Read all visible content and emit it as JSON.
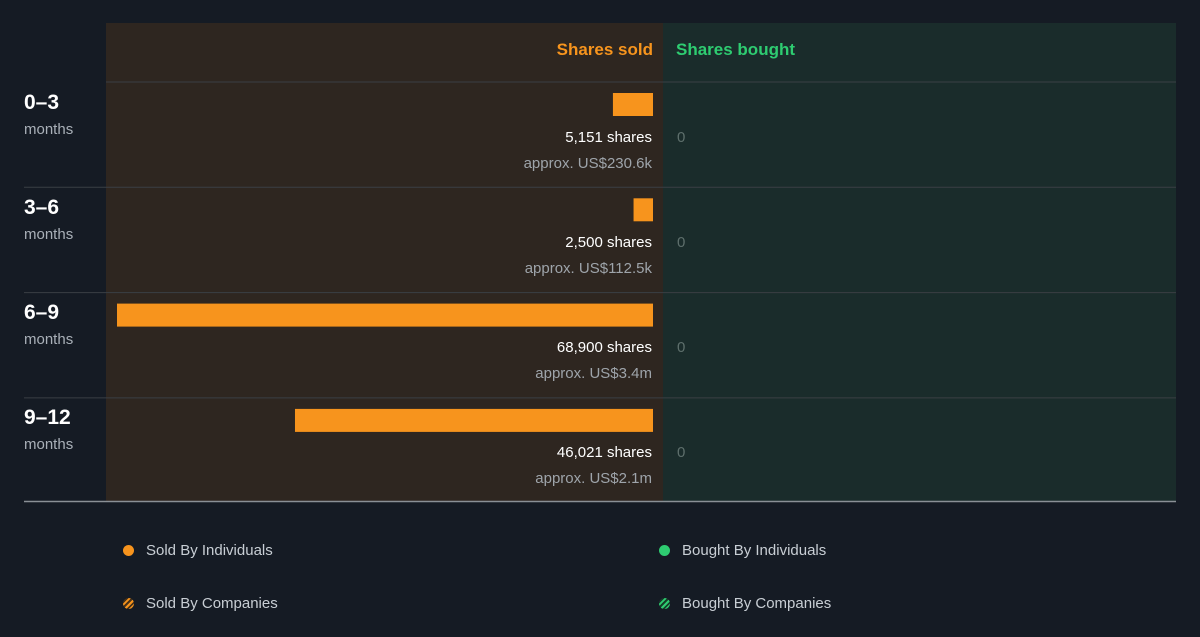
{
  "colors": {
    "sold": "#f7941d",
    "bought": "#2ecc71",
    "sold_bg": "#2e2620",
    "bought_bg": "#1a2c2b",
    "page_bg": "#151b24"
  },
  "headers": {
    "sold": "Shares sold",
    "bought": "Shares bought"
  },
  "rows": [
    {
      "period": "0–3",
      "unit": "months",
      "sold_shares": "5,151 shares",
      "sold_value": "approx. US$230.6k",
      "bought": "0"
    },
    {
      "period": "3–6",
      "unit": "months",
      "sold_shares": "2,500 shares",
      "sold_value": "approx. US$112.5k",
      "bought": "0"
    },
    {
      "period": "6–9",
      "unit": "months",
      "sold_shares": "68,900 shares",
      "sold_value": "approx. US$3.4m",
      "bought": "0"
    },
    {
      "period": "9–12",
      "unit": "months",
      "sold_shares": "46,021 shares",
      "sold_value": "approx. US$2.1m",
      "bought": "0"
    }
  ],
  "legend": {
    "sold_individuals": "Sold By Individuals",
    "bought_individuals": "Bought By Individuals",
    "sold_companies": "Sold By Companies",
    "bought_companies": "Bought By Companies"
  },
  "chart_data": {
    "type": "bar",
    "orientation": "horizontal",
    "categories": [
      "0–3 months",
      "3–6 months",
      "6–9 months",
      "9–12 months"
    ],
    "series": [
      {
        "name": "Shares sold",
        "values": [
          5151,
          2500,
          68900,
          46021
        ]
      },
      {
        "name": "Shares bought",
        "values": [
          0,
          0,
          0,
          0
        ]
      }
    ],
    "legend_position": "bottom"
  }
}
